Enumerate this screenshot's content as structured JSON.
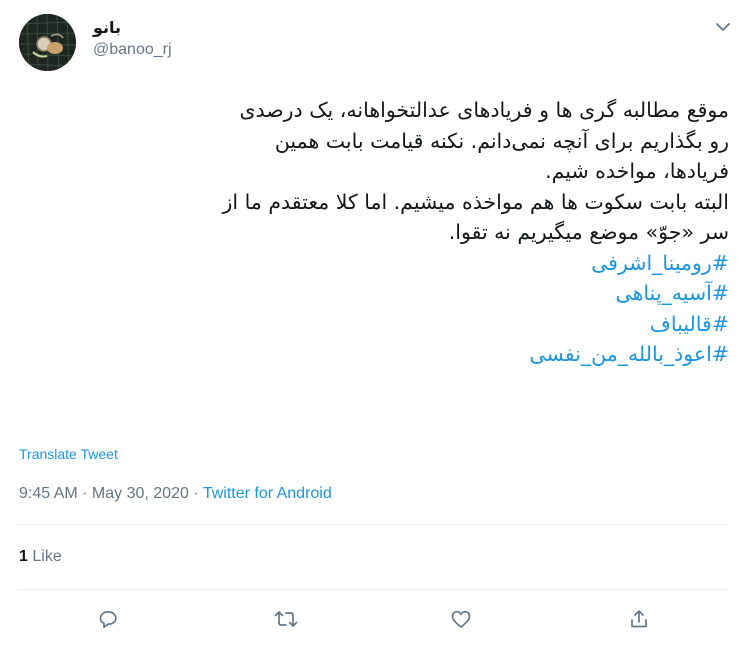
{
  "author": {
    "display_name": "بانو",
    "handle": "@banoo_rj"
  },
  "tweet": {
    "lines": [
      "موقع مطالبه گری ها و فریادهای عدالتخواهانه، یک درصدی",
      "رو بگذاریم برای آنچه نمی‌دانم. نکنه قیامت بابت همین",
      "فریادها، مواخده شیم.",
      "البته بابت سکوت ها هم مواخذه میشیم. اما کلا معتقدم ما از",
      "سر «جوّ» موضع میگیریم نه تقوا."
    ],
    "hashtags": [
      "#رومینا_اشرفی",
      "#آسیه_پناهی",
      "#قالیباف",
      "#اعوذ_بالله_من_نفسی"
    ]
  },
  "translate_label": "Translate Tweet",
  "meta": {
    "time": "9:45 AM",
    "separator": " · ",
    "date": "May 30, 2020",
    "separator2": " · ",
    "source": "Twitter for Android"
  },
  "likes": {
    "count": "1",
    "label": "Like"
  },
  "icons": {
    "caret": "chevron-down-icon",
    "reply": "reply-icon",
    "retweet": "retweet-icon",
    "like": "heart-icon",
    "share": "share-icon"
  },
  "colors": {
    "link": "#1b95e0",
    "muted": "#657786",
    "text": "#14171a",
    "divider": "#e6ecf0"
  }
}
